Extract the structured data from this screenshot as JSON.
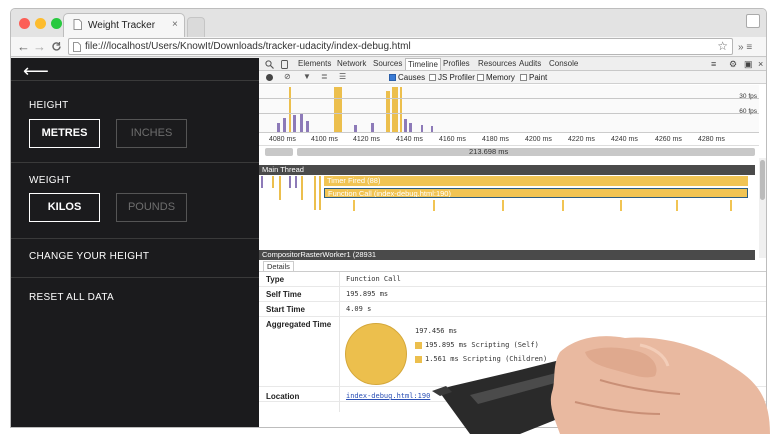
{
  "browser": {
    "tab_title": "Weight Tracker",
    "tab_close": "×",
    "back": "←",
    "forward": "→",
    "reload": "C",
    "url": "file:///localhost/Users/KnowIt/Downloads/tracker-udacity/index-debug.html",
    "star": "☆",
    "menu": "» ≡"
  },
  "app": {
    "back_arrow": "⟵",
    "height_label": "HEIGHT",
    "metres": "METRES",
    "inches": "INCHES",
    "weight_label": "WEIGHT",
    "kilos": "KILOS",
    "pounds": "POUNDS",
    "change_height": "CHANGE YOUR HEIGHT",
    "reset": "RESET ALL DATA"
  },
  "devtools": {
    "tabs": [
      "Elements",
      "Network",
      "Sources",
      "Timeline",
      "Profiles",
      "Resources",
      "Audits",
      "Console"
    ],
    "selected_tab": "Timeline",
    "toolbar": {
      "causes": "Causes",
      "js_profiler": "JS Profiler",
      "memory": "Memory",
      "paint": "Paint"
    },
    "fps_30": "30 fps",
    "fps_60": "60 fps",
    "ruler_ticks": [
      "4080 ms",
      "4100 ms",
      "4120 ms",
      "4140 ms",
      "4160 ms",
      "4180 ms",
      "4200 ms",
      "4220 ms",
      "4240 ms",
      "4260 ms",
      "4280 ms"
    ],
    "duration": "213.698 ms",
    "main_thread": "Main Thread",
    "timer_fired": "Timer Fired (88)",
    "function_call": "Function Call (index-debug.html:190)",
    "compositor": "CompositorRasterWorker1 (28931",
    "details_tab": "Details",
    "details": {
      "type_key": "Type",
      "type_val": "Function Call",
      "self_time_key": "Self Time",
      "self_time_val": "195.895 ms",
      "start_time_key": "Start Time",
      "start_time_val": "4.09 s",
      "aggregated_key": "Aggregated Time",
      "aggregated_total": "197.456 ms",
      "legend_1": "195.895 ms Scripting (Self)",
      "legend_2": "1.561 ms Scripting (Children)",
      "location_key": "Location",
      "location_val": "index-debug.html:190"
    }
  },
  "colors": {
    "scripting": "#ecbf4d",
    "app_bg": "#1b1b1d",
    "thread_header": "#4a4a4a"
  }
}
